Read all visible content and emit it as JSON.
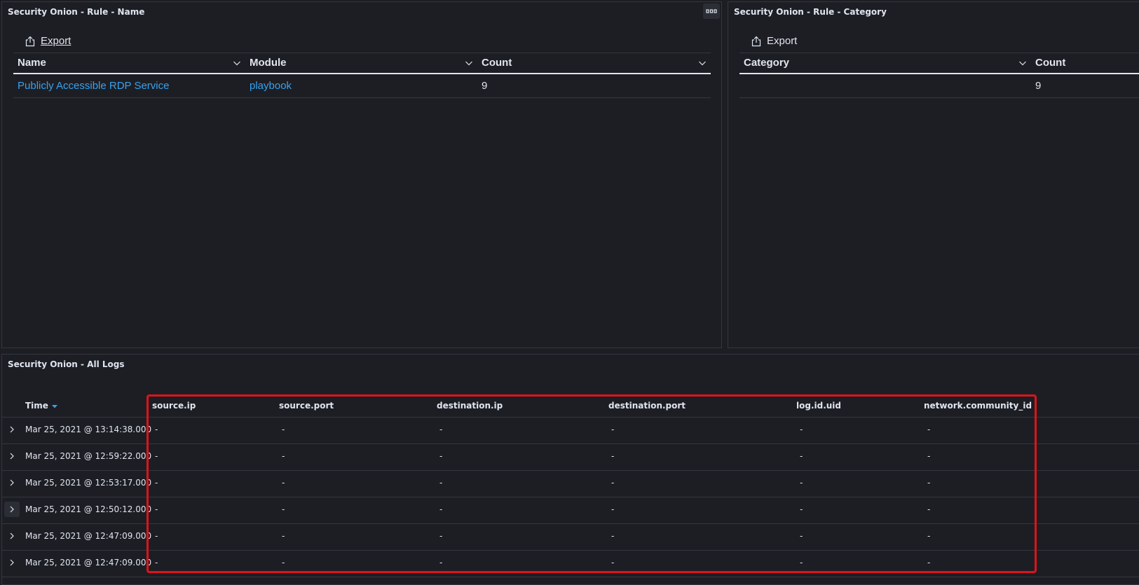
{
  "panels": {
    "rule_name": {
      "title": "Security Onion - Rule - Name",
      "export_label": "Export",
      "columns": [
        "Name",
        "Module",
        "Count"
      ],
      "rows": [
        {
          "name": "Publicly Accessible RDP Service",
          "module": "playbook",
          "count": "9"
        }
      ]
    },
    "rule_category": {
      "title": "Security Onion - Rule - Category",
      "export_label": "Export",
      "columns": [
        "Category",
        "Count"
      ],
      "rows": [
        {
          "category": "",
          "count": "9"
        }
      ]
    },
    "all_logs": {
      "title": "Security Onion - All Logs",
      "columns": [
        "Time",
        "source.ip",
        "source.port",
        "destination.ip",
        "destination.port",
        "log.id.uid",
        "network.community_id"
      ],
      "sort": "descending",
      "rows": [
        {
          "time": "Mar 25, 2021 @ 13:14:38.000",
          "values": [
            "-",
            "-",
            "-",
            "-",
            "-",
            "-"
          ]
        },
        {
          "time": "Mar 25, 2021 @ 12:59:22.000",
          "values": [
            "-",
            "-",
            "-",
            "-",
            "-",
            "-"
          ]
        },
        {
          "time": "Mar 25, 2021 @ 12:53:17.000",
          "values": [
            "-",
            "-",
            "-",
            "-",
            "-",
            "-"
          ]
        },
        {
          "time": "Mar 25, 2021 @ 12:50:12.000",
          "values": [
            "-",
            "-",
            "-",
            "-",
            "-",
            "-"
          ]
        },
        {
          "time": "Mar 25, 2021 @ 12:47:09.000",
          "values": [
            "-",
            "-",
            "-",
            "-",
            "-",
            "-"
          ]
        },
        {
          "time": "Mar 25, 2021 @ 12:47:09.000",
          "values": [
            "-",
            "-",
            "-",
            "-",
            "-",
            "-"
          ]
        }
      ]
    }
  },
  "icons": {
    "export": "share-upload-icon",
    "column_menu": "chevron-down-icon",
    "row_expand": "chevron-right-icon",
    "sort": "sort-descending-icon",
    "panel_options": "more-horizontal-icon"
  },
  "colors": {
    "background": "#1d1e24",
    "link": "#36a2ef",
    "border": "#343741",
    "highlight": "#e0121a"
  }
}
